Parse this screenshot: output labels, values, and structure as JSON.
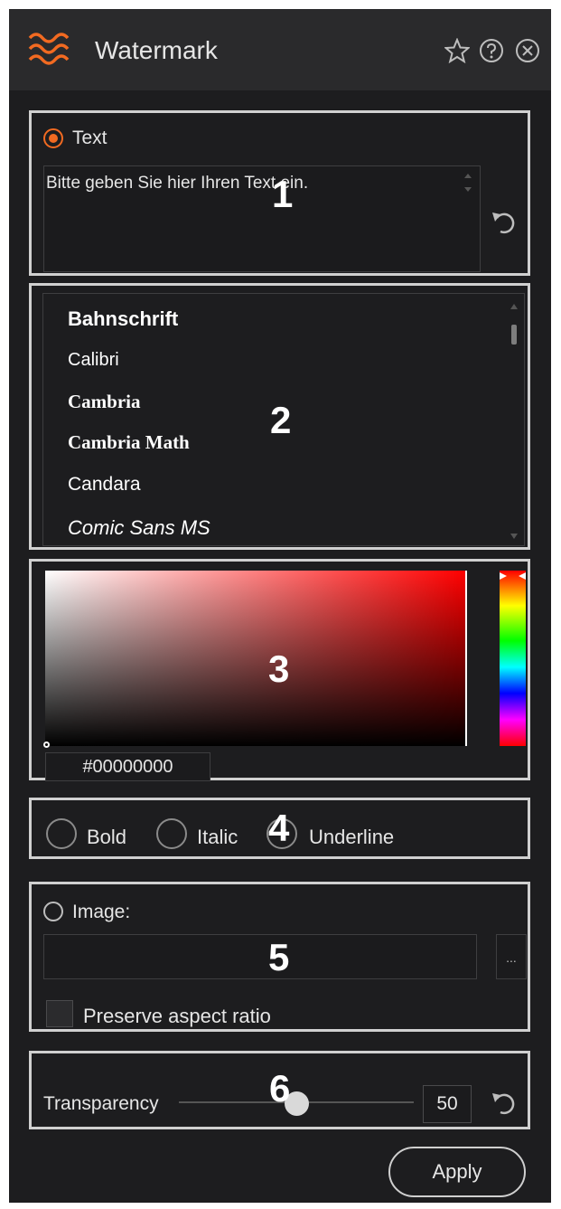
{
  "header": {
    "title": "Watermark",
    "icons": [
      "watermark-logo-icon",
      "star-icon",
      "help-icon",
      "close-icon"
    ]
  },
  "text_section": {
    "number": "1",
    "radio_label": "Text",
    "text_value": "Bitte geben Sie hier Ihren Text ein.",
    "reset_icon": "undo-icon"
  },
  "font_section": {
    "number": "2",
    "fonts": [
      "Bahnschrift",
      "Calibri",
      "Cambria",
      "Cambria Math",
      "Candara",
      "Comic Sans MS"
    ]
  },
  "color_section": {
    "number": "3",
    "hex_value": "#00000000"
  },
  "style_section": {
    "number": "4",
    "bold_label": "Bold",
    "italic_label": "Italic",
    "underline_label": "Underline"
  },
  "image_section": {
    "number": "5",
    "radio_label": "Image:",
    "path_value": "",
    "browse_label": "...",
    "aspect_label": "Preserve aspect ratio"
  },
  "transparency_section": {
    "number": "6",
    "label": "Transparency",
    "value": "50",
    "reset_icon": "undo-icon"
  },
  "footer": {
    "apply_label": "Apply"
  },
  "colors": {
    "accent": "#f26a21",
    "panel": "#1d1d1f",
    "border": "#d0d0d0"
  }
}
